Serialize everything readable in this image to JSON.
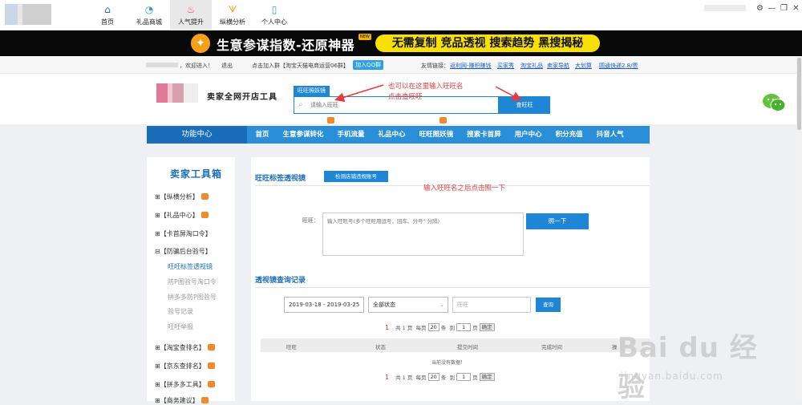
{
  "nav": {
    "items": [
      {
        "label": "首页",
        "icon": "home-icon",
        "glyph": "⌂"
      },
      {
        "label": "礼品商城",
        "icon": "shop-icon",
        "glyph": "◔"
      },
      {
        "label": "人气提升",
        "icon": "popularity-icon",
        "glyph": "♨"
      },
      {
        "label": "纵横分析",
        "icon": "analysis-icon",
        "glyph": "ᗐ"
      },
      {
        "label": "个人中心",
        "icon": "user-icon",
        "glyph": "▯"
      }
    ]
  },
  "window": {
    "settings": "⚙",
    "minimize": "—",
    "restore": "❐",
    "close": "✕"
  },
  "banner": {
    "title": "生意参谋指数-还原神器",
    "hot": "NEW",
    "pill": "无需复制 竞品透视 搜索趋势 黑搜揭秘"
  },
  "strip": {
    "welcome": "，欢迎进入！",
    "logout": "退出",
    "join": "点击加入群【淘宝天猫电商运营06群】",
    "qq": "加入QQ群",
    "friends_label": "友情链接：",
    "links": [
      "返利网-赚积赚钱",
      "买家秀",
      "淘宝礼品",
      "卖家导航",
      "大划算",
      "圆通快递2.8/票"
    ]
  },
  "header": {
    "brand": "卖家全网开店工具",
    "tag": "旺旺照妖镜",
    "search_placeholder": "请输入旺旺",
    "search_button": "查旺旺",
    "note1": "也可以在这里输入旺旺名",
    "note2": "点击查旺旺"
  },
  "menu": {
    "head": "功能中心",
    "items": [
      "首页",
      "生意参谋转化",
      "手机流量",
      "礼品中心",
      "旺旺照妖镜",
      "搜索卡首屏",
      "用户中心",
      "积分充值",
      "抖音人气"
    ]
  },
  "sidebar": {
    "title": "卖家工具箱",
    "items": [
      {
        "label": "【纵横分析】",
        "prefix": "⊞",
        "badge": true
      },
      {
        "label": "【礼品中心】",
        "prefix": "⊞",
        "badge": true
      },
      {
        "label": "【卡首屏淘口令】",
        "prefix": "⊞",
        "badge": false
      },
      {
        "label": "【防骗后台验号】",
        "prefix": "⊟",
        "badge": false
      }
    ],
    "subitems": [
      "旺旺标签透视镜",
      "防P图验号淘口令",
      "拼多多防P图验号",
      "验号记录",
      "旺旺举报"
    ],
    "items2": [
      {
        "label": "【淘宝查排名】",
        "prefix": "⊞",
        "badge": true
      },
      {
        "label": "【京东查排名】",
        "prefix": "⊞",
        "badge": true
      },
      {
        "label": "【拼多多工具】",
        "prefix": "⊞",
        "badge": true
      },
      {
        "label": "【商务建议】",
        "prefix": "⊞",
        "badge": true
      }
    ]
  },
  "main": {
    "title1": "旺旺标签透视镜",
    "check_button": "检测店铺违规账号",
    "note": "输入旺旺名之后点击照一下",
    "label": "旺旺：",
    "textarea_placeholder": "输入旺旺号(多个旺旺用逗号、回车、分号\" 分隔)",
    "zhao_button": "照一下",
    "title2": "透视镜查询记录",
    "date_range": "2019-03-18 - 2019-03-25",
    "status_select": "全部状态",
    "ww_placeholder": "旺旺",
    "query_button": "查询",
    "pager": {
      "current": "1",
      "total": "共 1 页",
      "per_page": "每页",
      "per_value": "20",
      "unit": "条",
      "goto": "到",
      "page_value": "1",
      "page_unit": "页",
      "ok": "确定"
    },
    "columns": [
      "旺旺",
      "状态",
      "提交时间",
      "完成时间",
      "操"
    ],
    "empty": "当前没有数据！"
  },
  "watermark": {
    "big": "Bai du 经验",
    "small": "jingyan.baidu.com"
  },
  "colors": {
    "accent": "#1f86d5",
    "menu": "#2a8ed8",
    "note": "#e83a3a",
    "banner_yellow": "#f8e100"
  }
}
